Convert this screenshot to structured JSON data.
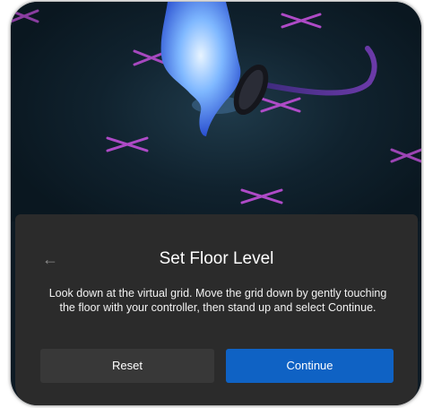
{
  "dialog": {
    "back_icon": "back-arrow-icon",
    "back_glyph": "←",
    "title": "Set Floor Level",
    "body": "Look down at the virtual grid. Move the grid down by gently touching the floor with your controller, then stand up and select Continue."
  },
  "buttons": {
    "reset_label": "Reset",
    "continue_label": "Continue"
  },
  "colors": {
    "dialog_bg": "#2b2b2b",
    "reset_bg": "#383838",
    "continue_bg": "#0f62c4",
    "grid_marker": "#c04fd8",
    "hand_glow": "#6fb3ff"
  },
  "scene": {
    "markers_icon": "grid-marker-icon",
    "hand_icon": "hand-controller-icon"
  }
}
